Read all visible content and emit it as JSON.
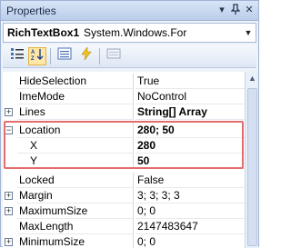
{
  "window": {
    "title": "Properties",
    "pin_glyph": "▾",
    "pushpin_glyph": "2",
    "close_glyph": "✕"
  },
  "selector": {
    "object_name": "RichTextBox1",
    "object_type": "System.Windows.For",
    "dropdown_glyph": "▼"
  },
  "toolbar": {
    "categorized_icon": "☰",
    "alphabetical_icon": "A↓",
    "properties_icon": "≡",
    "events_icon": "⚡",
    "property_pages_icon": "▤"
  },
  "grid": {
    "rows": [
      {
        "name": "HideSelection",
        "value": "True",
        "expandable": false,
        "sub": false,
        "bold": false
      },
      {
        "name": "ImeMode",
        "value": "NoControl",
        "expandable": false,
        "sub": false,
        "bold": false
      },
      {
        "name": "Lines",
        "value": "String[] Array",
        "expandable": true,
        "expander": "+",
        "sub": false,
        "bold": true
      },
      {
        "name": "Location",
        "value": "280; 50",
        "expandable": true,
        "expander": "−",
        "sub": false,
        "bold": true
      },
      {
        "name": "X",
        "value": "280",
        "expandable": false,
        "sub": true,
        "bold": true
      },
      {
        "name": "Y",
        "value": "50",
        "expandable": false,
        "sub": true,
        "bold": true
      },
      {
        "name": "Locked",
        "value": "False",
        "expandable": false,
        "sub": false,
        "bold": false
      },
      {
        "name": "Margin",
        "value": "3; 3; 3; 3",
        "expandable": true,
        "expander": "+",
        "sub": false,
        "bold": false
      },
      {
        "name": "MaximumSize",
        "value": "0; 0",
        "expandable": true,
        "expander": "+",
        "sub": false,
        "bold": false
      },
      {
        "name": "MaxLength",
        "value": "2147483647",
        "expandable": false,
        "sub": false,
        "bold": false
      },
      {
        "name": "MinimumSize",
        "value": "0; 0",
        "expandable": true,
        "expander": "+",
        "sub": false,
        "bold": false
      }
    ]
  },
  "scrollbar": {
    "up_glyph": "▲"
  },
  "colors": {
    "highlight_border": "#e36d6d",
    "titlebar": "#c9d9f0",
    "active_button": "#ffe8a6"
  }
}
